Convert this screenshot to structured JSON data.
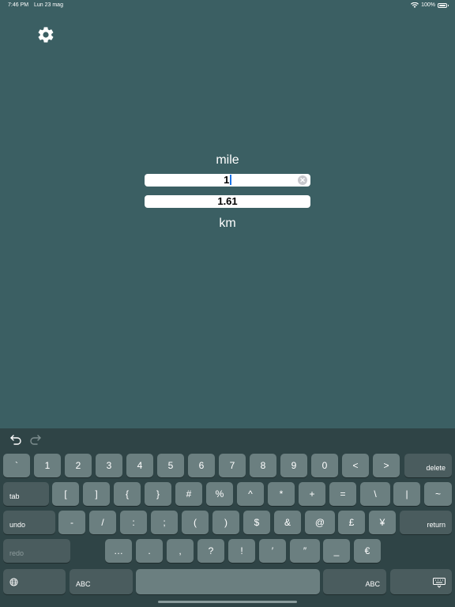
{
  "status_bar": {
    "time": "7:46 PM",
    "date": "Lun 23 mag",
    "battery": "100%"
  },
  "converter": {
    "from_unit": "mile",
    "from_value": "1",
    "to_value": "1.61",
    "to_unit": "km"
  },
  "keyboard": {
    "row1": [
      "`",
      "1",
      "2",
      "3",
      "4",
      "5",
      "6",
      "7",
      "8",
      "9",
      "0",
      "<",
      ">"
    ],
    "delete_label": "delete",
    "tab_label": "tab",
    "row2": [
      "[",
      "]",
      "{",
      "}",
      "#",
      "%",
      "^",
      "*",
      "+",
      "=",
      "\\",
      "|",
      "~"
    ],
    "undo_label": "undo",
    "row3": [
      "-",
      "/",
      ":",
      ";",
      "(",
      ")",
      "$",
      "&",
      "@",
      "£",
      "¥"
    ],
    "return_label": "return",
    "redo_label": "redo",
    "row4": [
      "…",
      ".",
      ",",
      "?",
      "!",
      "′",
      "″",
      "_",
      "€"
    ],
    "abc_label": "ABC"
  },
  "colors": {
    "background": "#3b5f63",
    "keyboard_background": "#2f4446",
    "key": "#6b7f80",
    "function_key": "#4a5c5e"
  }
}
